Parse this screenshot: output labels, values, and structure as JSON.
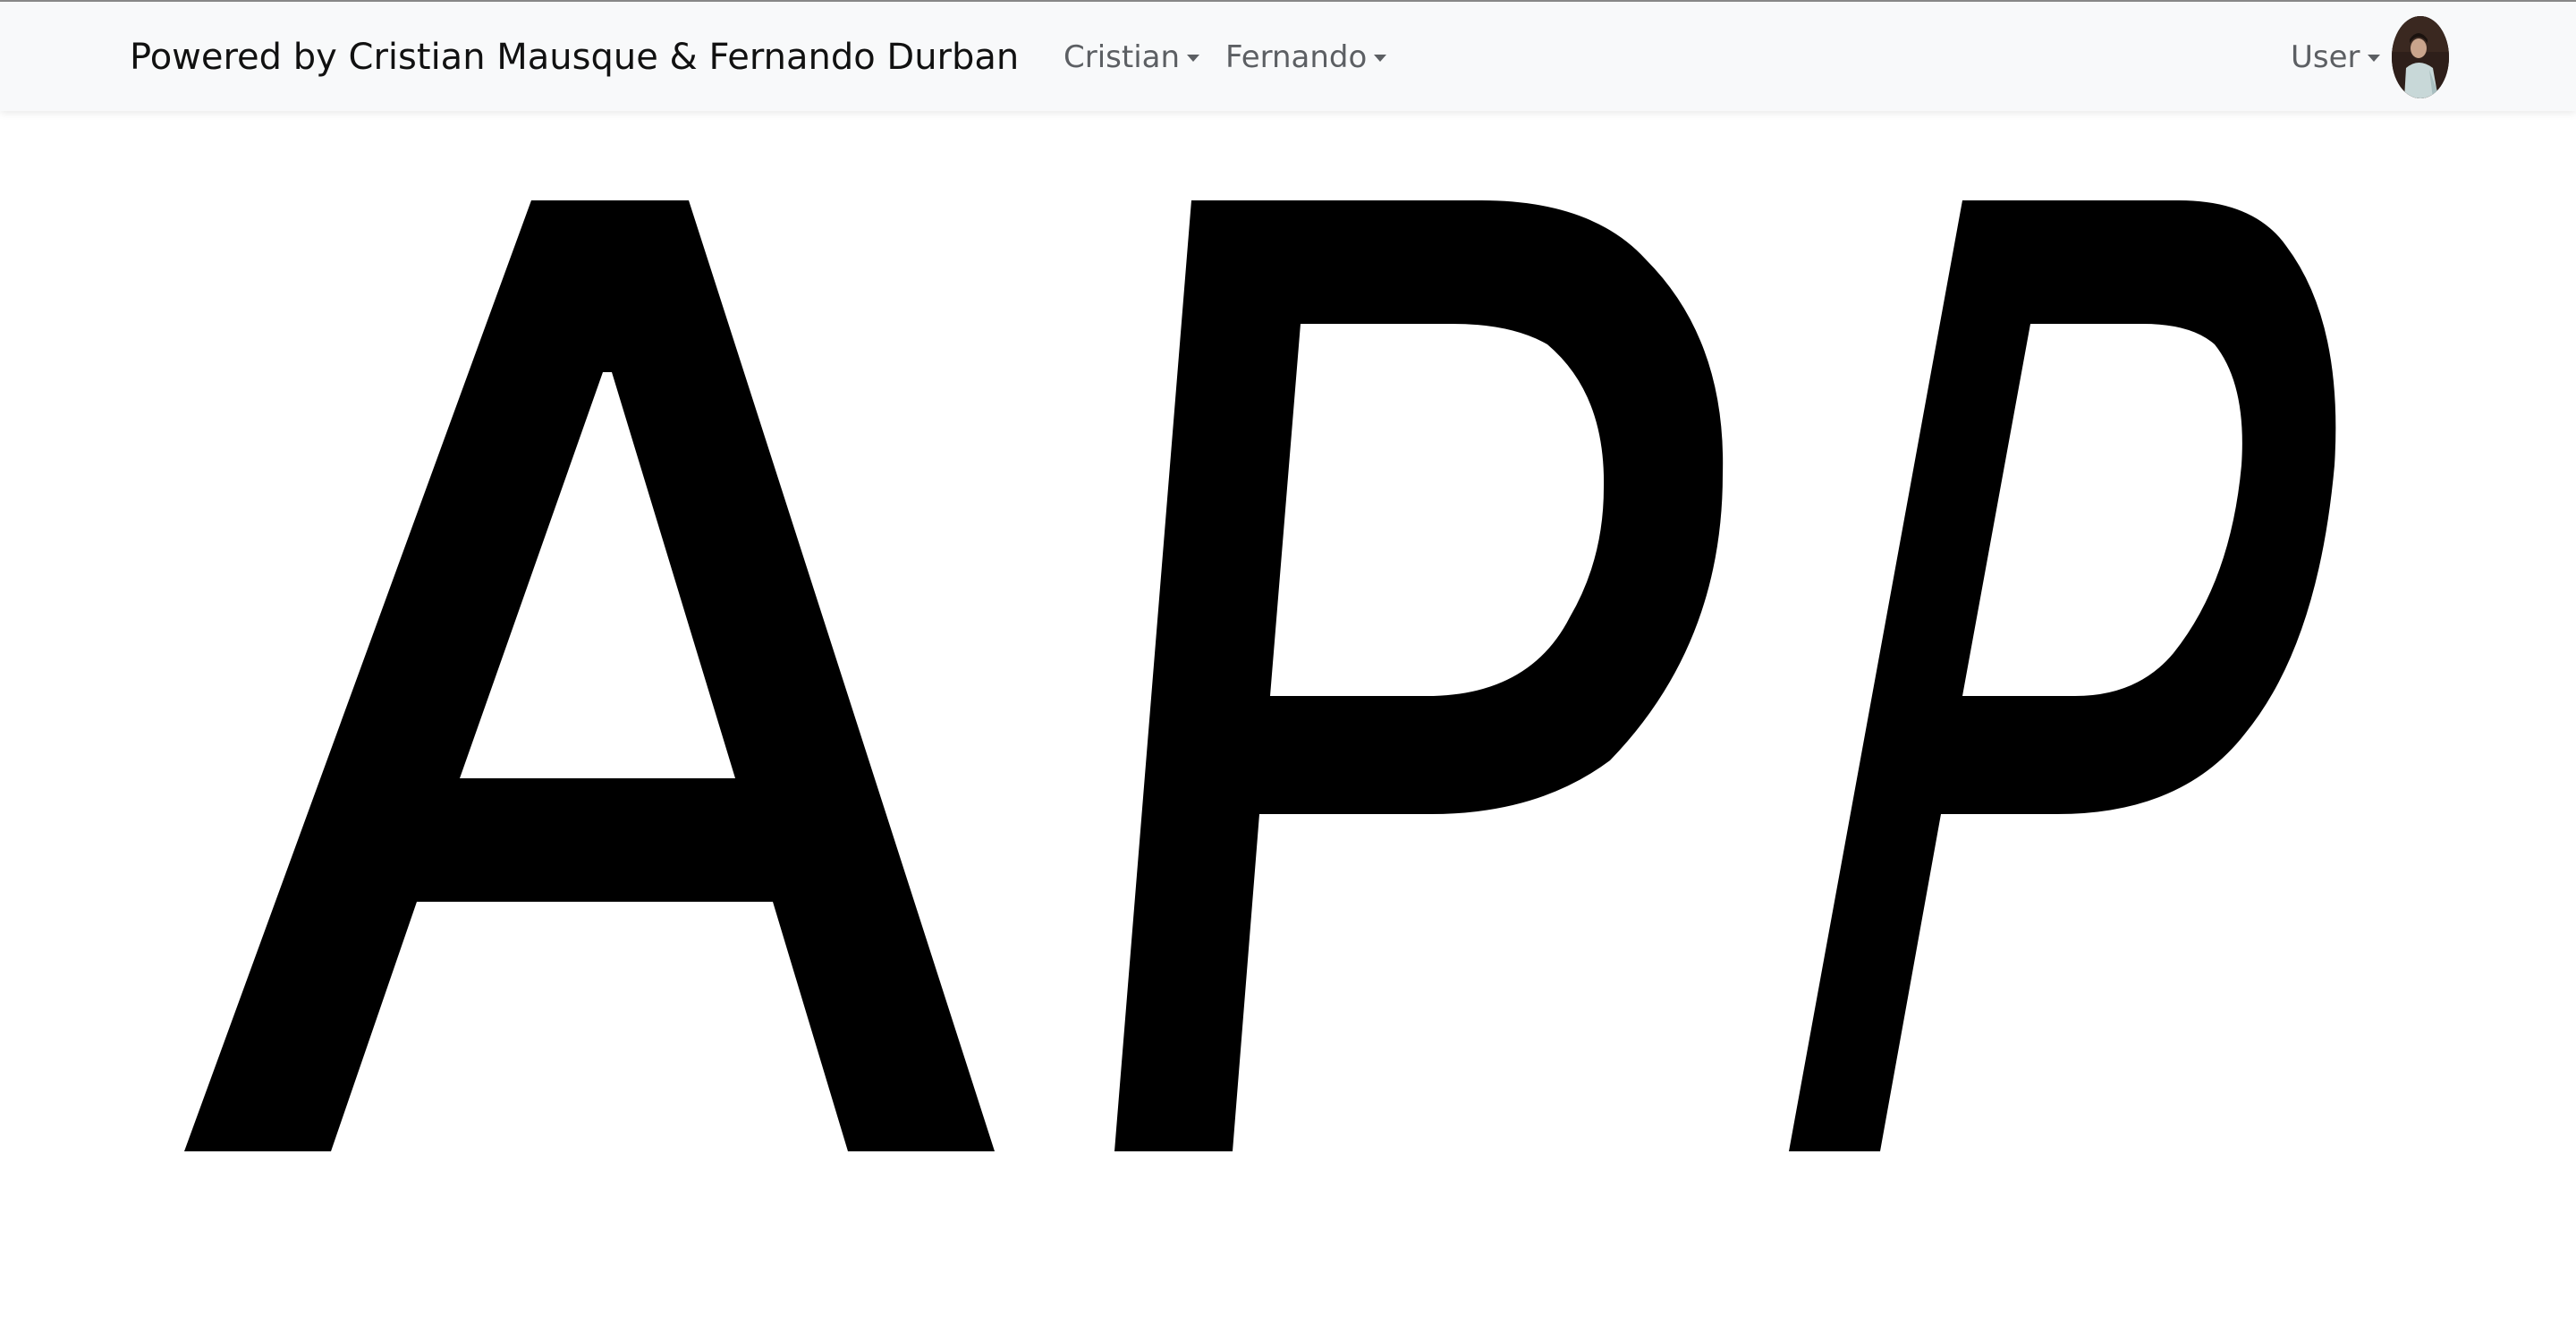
{
  "navbar": {
    "brand": "Powered by Cristian Mausque & Fernando Durban",
    "menus": [
      {
        "label": "Cristian"
      },
      {
        "label": "Fernando"
      }
    ],
    "user_menu": {
      "label": "User"
    },
    "avatar": {
      "icon": "user-avatar-photo"
    }
  },
  "hero": {
    "text": "APP",
    "color": "#000000"
  }
}
